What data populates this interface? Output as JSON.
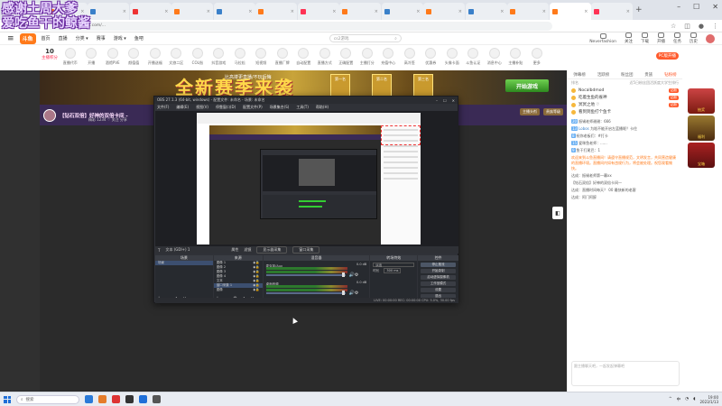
{
  "overlay": {
    "line1": "感谢土周大爹",
    "line2": "爱吃鱼干的鲸酱"
  },
  "browser": {
    "tabs": [
      {
        "title": "",
        "color": "#ff7a1a"
      },
      {
        "title": "",
        "color": "#ff7a1a"
      },
      {
        "title": "",
        "color": "#3a80c9"
      },
      {
        "title": "",
        "color": "#e33"
      },
      {
        "title": "",
        "color": "#ff7a1a"
      },
      {
        "title": "",
        "color": "#3a80c9"
      },
      {
        "title": "",
        "color": "#ff7a1a"
      },
      {
        "title": "",
        "color": "#f35"
      },
      {
        "title": "",
        "color": "#ff7a1a"
      },
      {
        "title": "",
        "color": "#3a80c9"
      },
      {
        "title": "",
        "color": "#ff7a1a"
      },
      {
        "title": "",
        "color": "#3a80c9"
      },
      {
        "title": "",
        "color": "#ff7a1a"
      },
      {
        "title": "",
        "color": "#ff7a1a"
      },
      {
        "title": "",
        "color": "#f35"
      }
    ],
    "url": "https://www.douyu.com/...",
    "new_tab": "+",
    "bookmarks": [
      "斗鱼包出好彩一...",
      "按键精灵 (*~'ω'~)",
      "蓝叮叮(要做"
    ]
  },
  "header": {
    "logo": "斗鱼",
    "nav": [
      "首页",
      "直播",
      "分类 ▾",
      "赛事",
      "游戏 ▾",
      "鱼吧"
    ],
    "search_placeholder": "cs2游戏",
    "user_items": [
      "Neverfashion",
      "关注",
      "下载",
      "开播",
      "任务",
      "历史"
    ]
  },
  "category_bar": {
    "first": {
      "count": "10",
      "label": "主播积分"
    },
    "items": [
      "直播代币",
      "开播",
      "酒馆PVE",
      "颜值值",
      "开播送福",
      "文旅二区",
      "COL指",
      "抖音游戏",
      "马拉松",
      "短视频",
      "直播厂牌",
      "自动配置",
      "直播方式",
      "正确配置",
      "主播打分",
      "充值中心",
      "高冷签",
      "优惠券",
      "头像卡面",
      "斗鱼认证",
      "消息中心",
      "主播补贴",
      "更多"
    ],
    "fire_badge": "PC版开播"
  },
  "banner": {
    "title": "全新赛季来袭",
    "subtitle": "比高搂更直播/不玩后悔",
    "medals": [
      "第一名",
      "第二名",
      "第三名"
    ],
    "button": "开始游戏"
  },
  "room": {
    "title": "【钻石双倍】好神的双倍卡间 -",
    "meta": "精彩  1234  ♡ 关注  分享",
    "badges": [
      "主播头衔",
      "贵族等级"
    ]
  },
  "chat": {
    "tabs": [
      "弹幕榜",
      "活跃榜",
      "粉丝团",
      "贵族",
      "钻粉榜"
    ],
    "rank_head": [
      "排名",
      "近5日粉丝团活跃度大学生排行"
    ],
    "ranks": [
      {
        "name": "Nocalbdmod",
        "tag": "钻粉"
      },
      {
        "name": "吃着生鱼的雀神",
        "tag": "钻粉"
      },
      {
        "name": "冥冥之地 ♡",
        "tag": "钻粉"
      },
      {
        "name": "看到到鱼打个鱼卡",
        "tag": ""
      }
    ],
    "messages": [
      {
        "lv": "20",
        "name": "",
        "text": "振锡老师谢谢：666",
        "sys": false
      },
      {
        "lv": "13",
        "name": "Lobos",
        "text": "为啥不能开启左蓝播呢？卡住",
        "sys": false
      },
      {
        "lv": "8",
        "name": "",
        "text": "祝你老板们：#打卡",
        "sys": false
      },
      {
        "lv": "15",
        "name": "",
        "text": "爱咪鱼老师：......",
        "sys": false
      },
      {
        "lv": "9",
        "name": "",
        "text": "鱼干打尾巴：1",
        "sys": false
      },
      {
        "lv": "",
        "name": "",
        "text": "欢迎来到斗鱼直播间！请遵守直播规范，文明发言，共同营造健康的直播环境。直播间内如有违规行为，将会被处理。祝您观看愉快。",
        "sys": true
      },
      {
        "lv": "",
        "name": "",
        "text": "达成：振锡老师第一幕xx",
        "sys": false
      },
      {
        "lv": "",
        "name": "",
        "text": "【钻石双倍】好神的双倍卡间一",
        "sys": false
      },
      {
        "lv": "",
        "name": "",
        "text": "达成：直播时间每天？ 00 最快新的老客",
        "sys": false
      },
      {
        "lv": "",
        "name": "",
        "text": "达成：阿门阿醉",
        "sys": false
      }
    ],
    "input_placeholder": "跟主播聊天吧，一起发起弹幕吧"
  },
  "right_widgets": [
    "抽奖",
    "福利",
    "宝箱"
  ],
  "obs": {
    "title": "OBS 27.1.3 (64-bit, windows) - 配置文件: 未命名 - 场景: 未命名",
    "menu": [
      "文件(F)",
      "编辑(E)",
      "视图(V)",
      "停靠窗口(D)",
      "配置文件(P)",
      "场景集合(S)",
      "工具(T)",
      "帮助(H)"
    ],
    "source_bar": [
      "属性",
      "滤镜",
      "显示器采集",
      "窗口采集"
    ],
    "source_label": "文本 (GDI+) 1",
    "docks": {
      "scenes": {
        "title": "场景",
        "items": [
          "场景"
        ]
      },
      "sources": {
        "title": "来源",
        "items": [
          "图像 1",
          "图像 2",
          "图像 3",
          "图像 4",
          "文本",
          "窗口采集 1",
          "图像"
        ]
      },
      "mixer": {
        "title": "混音器",
        "channels": [
          {
            "name": "麦克风/Aux",
            "db": "0.0 dB"
          },
          {
            "name": "桌面音频",
            "db": "0.0 dB"
          }
        ]
      },
      "transitions": {
        "title": "转场特效",
        "type": "淡出",
        "duration_label": "时长",
        "duration": "300 ms"
      },
      "controls": {
        "title": "控件",
        "buttons": [
          "停止推流",
          "开始录制",
          "启动虚拟摄像机",
          "工作室模式",
          "设置",
          "退出"
        ]
      }
    },
    "status": "LIVE: 00:00:00  REC: 00:00:00  CPU: 5.0%, 30.00 fps"
  },
  "taskbar": {
    "search": "搜索",
    "apps": [
      "#2a7ad8",
      "#e57c2a",
      "#d33",
      "#333",
      "#1f6fd8",
      "#555"
    ],
    "time": "19:00",
    "date": "2023/1/13",
    "tray": [
      "^",
      "中"
    ]
  }
}
